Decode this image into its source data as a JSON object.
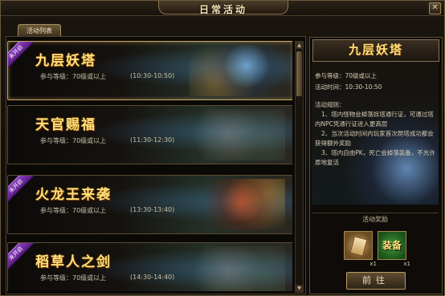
{
  "window": {
    "title": "日常活动",
    "close_symbol": "✕"
  },
  "tabs": [
    {
      "label": "活动列表"
    }
  ],
  "events": [
    {
      "badge": "未开启",
      "name": "九层妖塔",
      "level": "参与等级：70级或以上",
      "time": "(10:30-10:50)"
    },
    {
      "badge": "未开启",
      "name": "天官赐福",
      "level": "参与等级：70级或以上",
      "time": "(11:30-12:30)"
    },
    {
      "badge": "未开启",
      "name": "火龙王来袭",
      "level": "参与等级：70级或以上",
      "time": "(13:30-13:40)"
    },
    {
      "badge": "未开启",
      "name": "稻草人之剑",
      "level": "参与等级：70级或以上",
      "time": "(14:30-14:40)"
    }
  ],
  "detail": {
    "title": "九层妖塔",
    "level": "参与等级：70级或以上",
    "time": "活动时间：10:30-10:50",
    "rules_title": "活动规则：",
    "rules": [
      "1、塔内怪物会掉落妖塔通行证，可通过塔内NPC凭通行证进入更高层",
      "2、当次活动时间内玩家首次爬塔成功都会获得额外奖励",
      "3、塔内自由PK，死亡会掉落装备，不允许原地复活"
    ],
    "rewards_label": "活动奖励",
    "rewards": [
      {
        "icon": "scroll-icon",
        "count": "x1"
      },
      {
        "icon": "equipment-icon",
        "label": "装备",
        "count": "x1"
      }
    ],
    "go_button": "前往"
  }
}
